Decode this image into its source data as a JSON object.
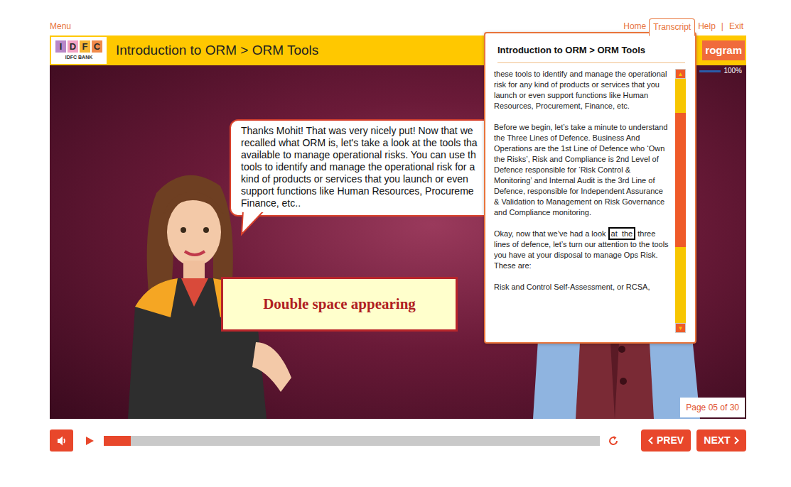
{
  "top_links": {
    "menu": "Menu",
    "items": [
      {
        "label": "Home",
        "selected": false
      },
      {
        "label": "Transcript",
        "selected": true
      },
      {
        "label": "Help",
        "selected": false
      },
      {
        "label": "Exit",
        "selected": false
      }
    ],
    "separator": "|"
  },
  "header": {
    "logo": {
      "letters": [
        {
          "letter": "I",
          "color": "#b887c8"
        },
        {
          "letter": "D",
          "color": "#f2a2c4"
        },
        {
          "letter": "F",
          "color": "#f7b733"
        },
        {
          "letter": "C",
          "color": "#f08a4b"
        }
      ],
      "bank": "IDFC BANK"
    },
    "title": "Introduction to ORM > ORM Tools",
    "program": "rogram",
    "progress": {
      "level": 1,
      "reading": "100%"
    }
  },
  "speech_bubble": {
    "lines": [
      "Thanks Mohit! That was very nicely put! Now that we",
      "recalled what ORM is, let's take a look at the tools tha",
      "available to manage operational risks. You can use th",
      "tools to identify and manage the operational risk for a",
      "kind of products or services that you launch or even",
      "support functions like Human Resources, Procureme",
      "Finance, etc.."
    ]
  },
  "annotation": {
    "text": "Double space appearing"
  },
  "transcript": {
    "title": "Introduction to ORM > ORM Tools",
    "paragraphs": [
      {
        "segments": [
          {
            "text": "these tools to identify and manage the operational risk for any kind of products or services that you launch or even support functions like Human Resources, Procurement, Finance, etc.",
            "highlighted": false
          }
        ]
      },
      {
        "segments": [
          {
            "text": "Before we begin, let’s take a minute to understand the Three Lines of Defence. Business And Operations are the 1st Line of Defence who ‘Own the Risks’, Risk and Compliance is 2nd Level of Defence responsible for ‘Risk Control & Monitoring’ and Internal Audit is the 3rd Line of Defence, responsible for Independent Assurance & Validation to Management on Risk Governance and Compliance monitoring.",
            "highlighted": false
          }
        ]
      },
      {
        "segments": [
          {
            "text": "Okay, now that we’ve had a look ",
            "highlighted": false
          },
          {
            "text": "at  the",
            "highlighted": true
          },
          {
            "text": " three lines of defence, let’s turn our attention to the tools you have at your disposal to manage Ops Risk. These are:",
            "highlighted": false
          }
        ]
      },
      {
        "segments": [
          {
            "text": "Risk and Control Self-Assessment, or RCSA,",
            "highlighted": false
          }
        ]
      }
    ],
    "scrollbar": {
      "up": "▲",
      "down": "▼",
      "level": 0.55,
      "position": 0.14
    }
  },
  "page_indicator": "Page 05 of 30",
  "controls": {
    "progress": {
      "level": 0.055
    },
    "prev": "PREV",
    "next": "NEXT"
  }
}
